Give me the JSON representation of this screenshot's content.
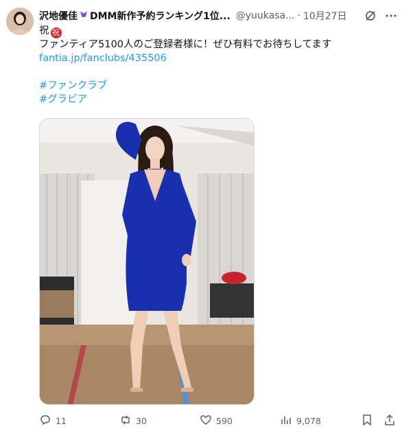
{
  "tweet": {
    "display_name": "沢地優佳",
    "name_suffix": "DMM新作予約ランキング1位...",
    "handle": "@yuukasa...",
    "separator": "·",
    "time": "10月27日",
    "line1_prefix": "祝",
    "line1_badge": "祝",
    "line2": "ファンティア5100人のご登録者様に！ぜひ有料でお待ちしてます",
    "link": "fantia.jp/fanclubs/435506",
    "hashtags": [
      "#ファンクラブ",
      "#グラビア"
    ]
  },
  "icons": {
    "avatar": "avatar",
    "emoji": "purple-bikini-emoji",
    "grok": "grok-icon",
    "more": "more-icon",
    "reply": "reply-icon",
    "retweet": "retweet-icon",
    "like": "like-icon",
    "views": "views-icon",
    "bookmark": "bookmark-icon",
    "share": "share-icon"
  },
  "actions": {
    "replies": "11",
    "retweets": "30",
    "likes": "590",
    "views": "9,078"
  },
  "colors": {
    "link": "#1d9bf0",
    "text": "#0f1419",
    "muted": "#536471",
    "badge": "#d9242e",
    "dress": "#1a2fb0"
  }
}
